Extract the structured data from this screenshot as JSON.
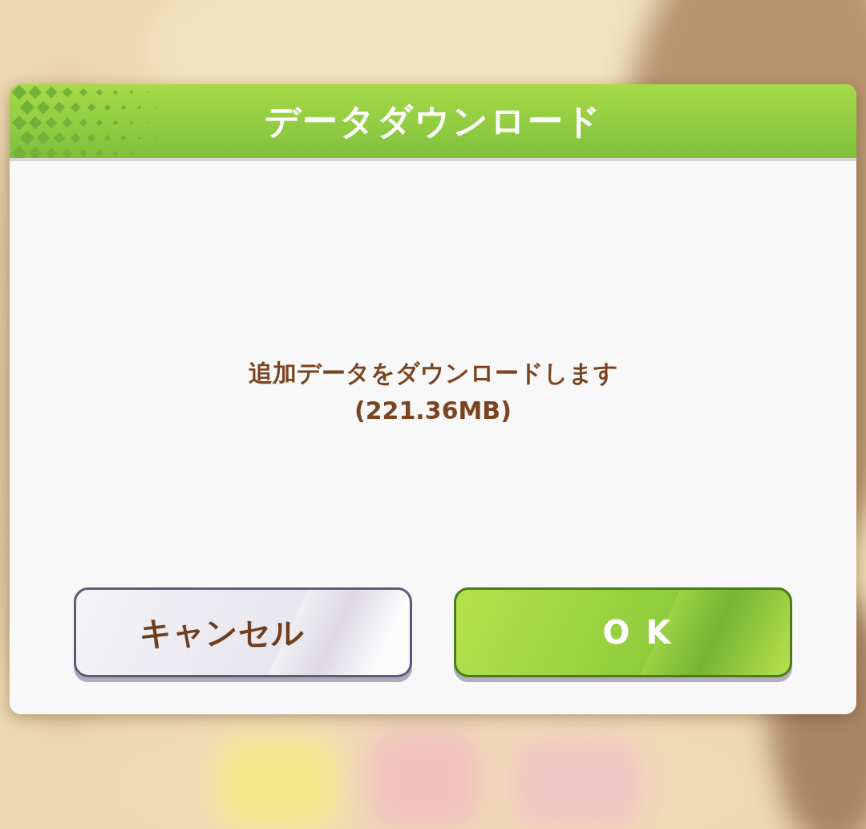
{
  "dialog": {
    "title": "データダウンロード",
    "message": [
      "追加データをダウンロードします",
      "(221.36MB)"
    ],
    "buttons": [
      {
        "label": "キャンセル",
        "kind": "secondary"
      },
      {
        "label": "OK",
        "kind": "primary"
      }
    ]
  }
}
